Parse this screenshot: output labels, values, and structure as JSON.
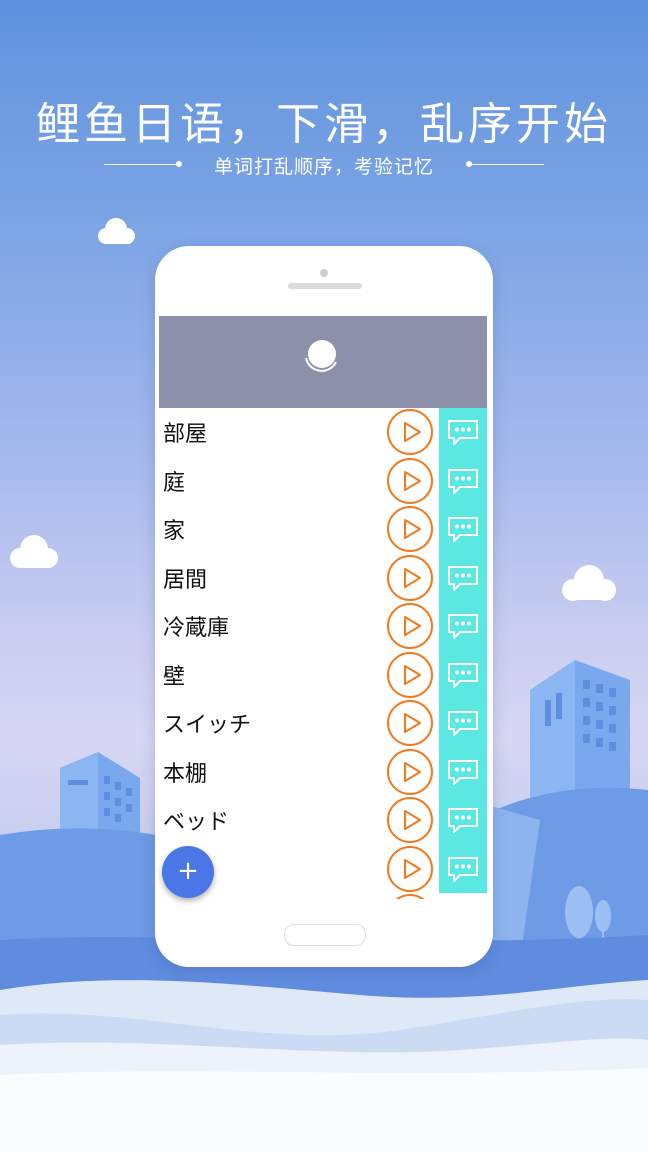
{
  "promo": {
    "headline": "鲤鱼日语，下滑，乱序开始",
    "subline": "单词打乱顺序，考验记忆"
  },
  "app": {
    "words": [
      {
        "label": "部屋"
      },
      {
        "label": "庭"
      },
      {
        "label": "家"
      },
      {
        "label": "居間"
      },
      {
        "label": "冷蔵庫"
      },
      {
        "label": "壁"
      },
      {
        "label": "スイッチ"
      },
      {
        "label": "本棚"
      },
      {
        "label": "ベッド"
      },
      {
        "label": ""
      }
    ],
    "fab_label": "+",
    "colors": {
      "play_accent": "#f07a1e",
      "more_bg": "#5ce8e2",
      "header_bg": "#8c90a9",
      "fab_bg": "#4a76e6"
    },
    "icons": {
      "play": "play-icon",
      "more": "speech-bubble-more-icon",
      "refresh": "refresh-spinner-icon"
    }
  }
}
